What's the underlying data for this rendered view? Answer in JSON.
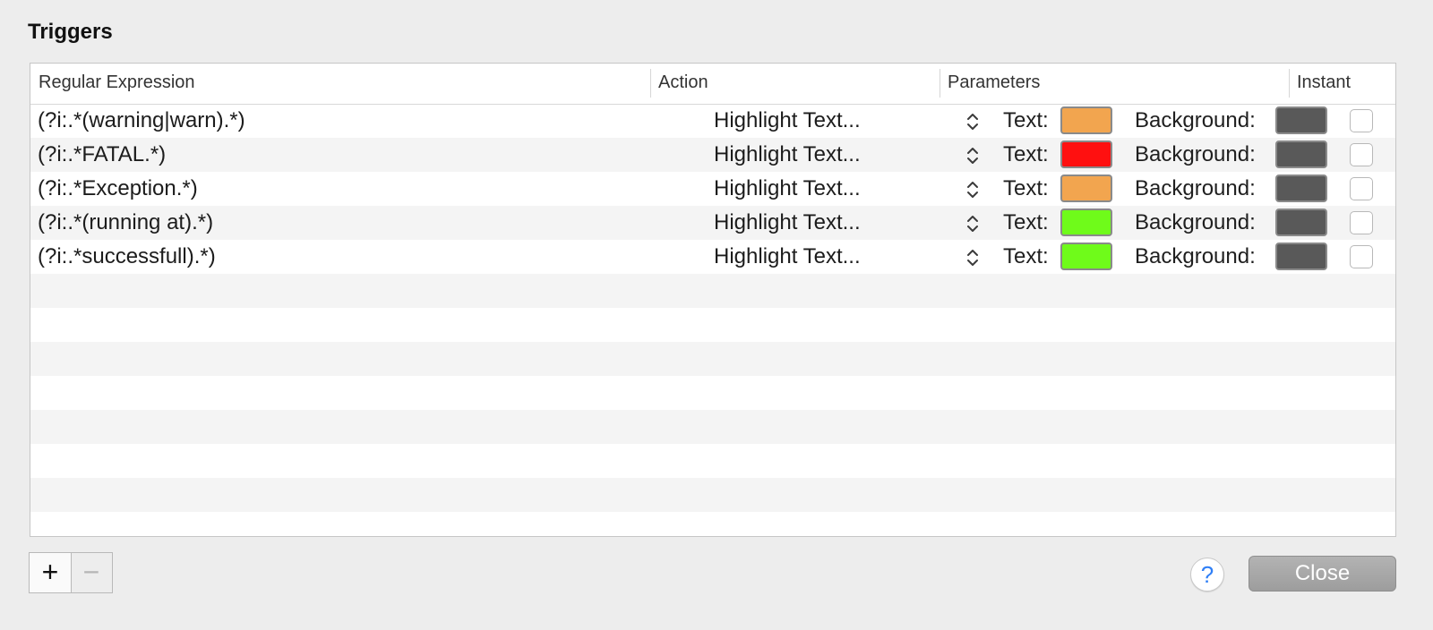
{
  "dialog": {
    "title": "Triggers"
  },
  "table": {
    "columns": {
      "regex": "Regular Expression",
      "action": "Action",
      "parameters": "Parameters",
      "instant": "Instant"
    },
    "text_label": "Text:",
    "background_label": "Background:",
    "rows": [
      {
        "regex": "(?i:.*(warning|warn).*)",
        "action": "Highlight Text...",
        "text_color": "#f2a54f",
        "background_color": "#595959",
        "instant": false
      },
      {
        "regex": "(?i:.*FATAL.*)",
        "action": "Highlight Text...",
        "text_color": "#ff1010",
        "background_color": "#595959",
        "instant": false
      },
      {
        "regex": "(?i:.*Exception.*)",
        "action": "Highlight Text...",
        "text_color": "#f2a54f",
        "background_color": "#595959",
        "instant": false
      },
      {
        "regex": "(?i:.*(running at).*)",
        "action": "Highlight Text...",
        "text_color": "#6ffb1a",
        "background_color": "#595959",
        "instant": false
      },
      {
        "regex": "(?i:.*successfull).*)",
        "action": "Highlight Text...",
        "text_color": "#6ffb1a",
        "background_color": "#595959",
        "instant": false
      }
    ]
  },
  "footer": {
    "add_label": "+",
    "remove_label": "−",
    "help_label": "?",
    "close_label": "Close"
  },
  "icons": {
    "stepper": "up-down-chevron-icon",
    "add": "plus-icon",
    "remove": "minus-icon",
    "help": "question-mark-icon"
  }
}
